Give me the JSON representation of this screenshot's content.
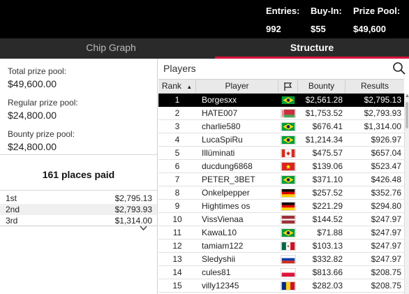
{
  "header": {
    "entries_label": "Entries:",
    "entries_value": "992",
    "buyin_label": "Buy-In:",
    "buyin_value": "$55",
    "prizepool_label": "Prize Pool:",
    "prizepool_value": "$49,600"
  },
  "tabs": [
    {
      "label": "Chip Graph",
      "active": false
    },
    {
      "label": "Structure",
      "active": true
    }
  ],
  "accent_color": "#d9143c",
  "prizes": {
    "total_label": "Total prize pool:",
    "total_value": "$49,600.00",
    "regular_label": "Regular prize pool:",
    "regular_value": "$24,800.00",
    "bounty_label": "Bounty prize pool:",
    "bounty_value": "$24,800.00"
  },
  "places": {
    "title": "161 places paid",
    "rows": [
      {
        "pos": "1st",
        "amount": "$2,795.13"
      },
      {
        "pos": "2nd",
        "amount": "$2,793.93"
      },
      {
        "pos": "3rd",
        "amount": "$1,314.00"
      }
    ],
    "expand_icon": "chevron-down-icon"
  },
  "players": {
    "title": "Players",
    "search_icon": "search-icon",
    "columns": {
      "rank": "Rank",
      "player": "Player",
      "flag_icon": "flag-icon",
      "bounty": "Bounty",
      "results": "Results"
    },
    "sort_indicator": "▲",
    "rows": [
      {
        "rank": "1",
        "name": "Borgesxx",
        "flag": "brazil",
        "bounty": "$2,561.28",
        "result": "$2,795.13",
        "selected": true
      },
      {
        "rank": "2",
        "name": "HATE007",
        "flag": "belarus",
        "bounty": "$1,753.52",
        "result": "$2,793.93"
      },
      {
        "rank": "3",
        "name": "charlie580",
        "flag": "brazil",
        "bounty": "$676.41",
        "result": "$1,314.00"
      },
      {
        "rank": "4",
        "name": "LucaSpiRu",
        "flag": "brazil",
        "bounty": "$1,214.34",
        "result": "$926.97"
      },
      {
        "rank": "5",
        "name": "Illüminati",
        "flag": "canada",
        "bounty": "$475.57",
        "result": "$657.04"
      },
      {
        "rank": "6",
        "name": "ducdung6868",
        "flag": "vietnam",
        "bounty": "$139.06",
        "result": "$523.47"
      },
      {
        "rank": "7",
        "name": "PETER_3BET",
        "flag": "brazil",
        "bounty": "$371.10",
        "result": "$426.48"
      },
      {
        "rank": "8",
        "name": "Onkelpepper",
        "flag": "germany",
        "bounty": "$257.52",
        "result": "$352.76"
      },
      {
        "rank": "9",
        "name": "Hightimes os",
        "flag": "germany",
        "bounty": "$221.29",
        "result": "$294.80"
      },
      {
        "rank": "10",
        "name": "VissVienaa",
        "flag": "latvia",
        "bounty": "$144.52",
        "result": "$247.97"
      },
      {
        "rank": "11",
        "name": "KawaL10",
        "flag": "brazil",
        "bounty": "$71.88",
        "result": "$247.97"
      },
      {
        "rank": "12",
        "name": "tamiam122",
        "flag": "mexico",
        "bounty": "$103.13",
        "result": "$247.97"
      },
      {
        "rank": "13",
        "name": "Sledyshii",
        "flag": "russia",
        "bounty": "$332.82",
        "result": "$247.97"
      },
      {
        "rank": "14",
        "name": "cules81",
        "flag": "poland",
        "bounty": "$813.66",
        "result": "$208.75"
      },
      {
        "rank": "15",
        "name": "villy12345",
        "flag": "romania",
        "bounty": "$282.03",
        "result": "$208.75"
      }
    ]
  }
}
